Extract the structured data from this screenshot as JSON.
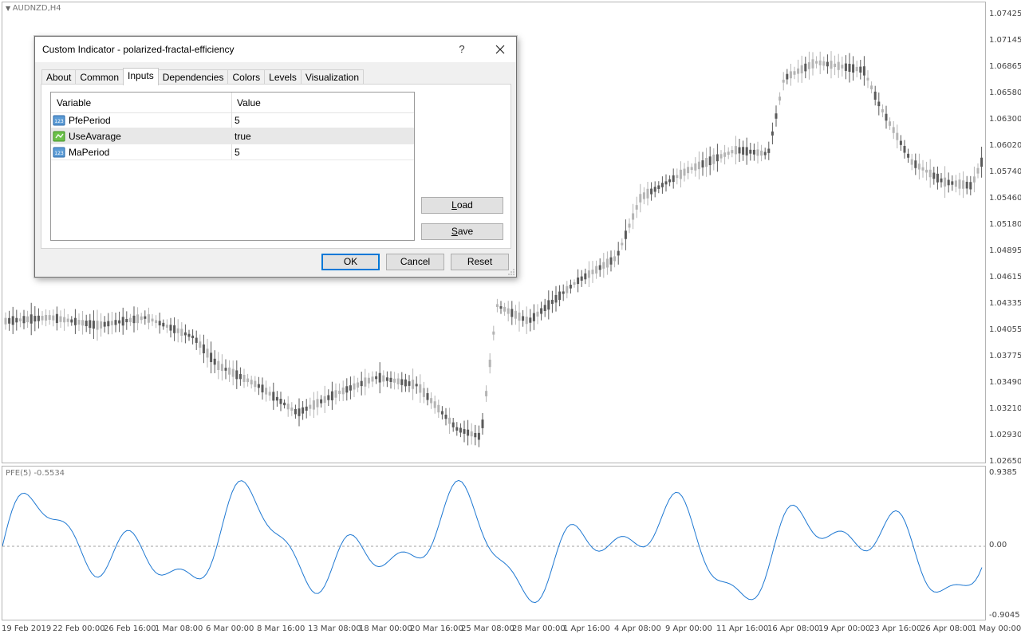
{
  "chart": {
    "symbol_label": "AUDNZD,H4",
    "price_axis": [
      "1.07425",
      "1.07145",
      "1.06865",
      "1.06580",
      "1.06300",
      "1.06020",
      "1.05740",
      "1.05460",
      "1.05180",
      "1.04895",
      "1.04615",
      "1.04335",
      "1.04055",
      "1.03775",
      "1.03490",
      "1.03210",
      "1.02930",
      "1.02650"
    ],
    "time_axis": [
      "19 Feb 2019",
      "22 Feb 00:00",
      "26 Feb 16:00",
      "1 Mar 08:00",
      "6 Mar 00:00",
      "8 Mar 16:00",
      "13 Mar 08:00",
      "18 Mar 00:00",
      "20 Mar 16:00",
      "25 Mar 08:00",
      "28 Mar 00:00",
      "1 Apr 16:00",
      "4 Apr 08:00",
      "9 Apr 00:00",
      "11 Apr 16:00",
      "16 Apr 08:00",
      "19 Apr 00:00",
      "23 Apr 16:00",
      "26 Apr 08:00",
      "1 May 00:00"
    ],
    "colors": {
      "bull_candle": "#b4b4b4",
      "bear_candle": "#5a5a5a",
      "indicator_line": "#1e78d2",
      "zero_line": "#a0a0a0"
    }
  },
  "indicator": {
    "label": "PFE(5) -0.5534",
    "axis": [
      "0.9385",
      "0.00",
      "-0.9045"
    ]
  },
  "dialog": {
    "title": "Custom Indicator - polarized-fractal-efficiency",
    "help_label": "?",
    "tabs": [
      {
        "label": "About"
      },
      {
        "label": "Common"
      },
      {
        "label": "Inputs"
      },
      {
        "label": "Dependencies"
      },
      {
        "label": "Colors"
      },
      {
        "label": "Levels"
      },
      {
        "label": "Visualization"
      }
    ],
    "active_tab": "Inputs",
    "grid": {
      "col_variable": "Variable",
      "col_value": "Value",
      "rows": [
        {
          "name": "PfePeriod",
          "value": "5",
          "icon": "integer-icon"
        },
        {
          "name": "UseAvarage",
          "value": "true",
          "icon": "boolean-icon"
        },
        {
          "name": "MaPeriod",
          "value": "5",
          "icon": "integer-icon"
        }
      ]
    },
    "load_label_first": "L",
    "load_label_rest": "oad",
    "save_label_first": "S",
    "save_label_rest": "ave",
    "ok_label": "OK",
    "cancel_label": "Cancel",
    "reset_label": "Reset"
  }
}
